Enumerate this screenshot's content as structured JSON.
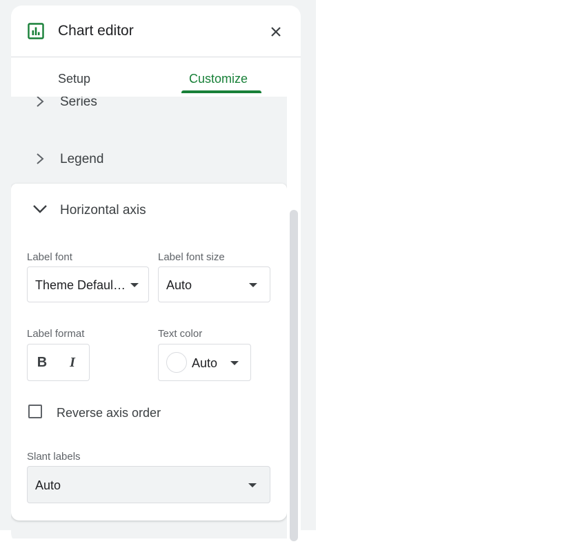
{
  "editor": {
    "title": "Chart editor",
    "tabs": [
      {
        "label": "Setup",
        "active": false
      },
      {
        "label": "Customize",
        "active": true
      }
    ],
    "accent_color": "#188038"
  },
  "sections": {
    "series": {
      "label": "Series"
    },
    "legend": {
      "label": "Legend"
    },
    "horizontal_axis": {
      "label": "Horizontal axis",
      "label_font": {
        "label": "Label font",
        "value": "Theme Defaul…"
      },
      "label_font_size": {
        "label": "Label font size",
        "value": "Auto"
      },
      "label_format": {
        "label": "Label format",
        "bold": "B",
        "italic": "I"
      },
      "text_color": {
        "label": "Text color",
        "value": "Auto"
      },
      "reverse_axis_order": {
        "label": "Reverse axis order",
        "checked": false
      },
      "slant_labels": {
        "label": "Slant labels",
        "value": "Auto"
      }
    }
  },
  "icons": {
    "chart": "chart-icon",
    "close": "close-icon",
    "chevron_right": "chevron-right-icon",
    "chevron_down": "chevron-down-icon",
    "caret_down": "caret-down-icon"
  }
}
